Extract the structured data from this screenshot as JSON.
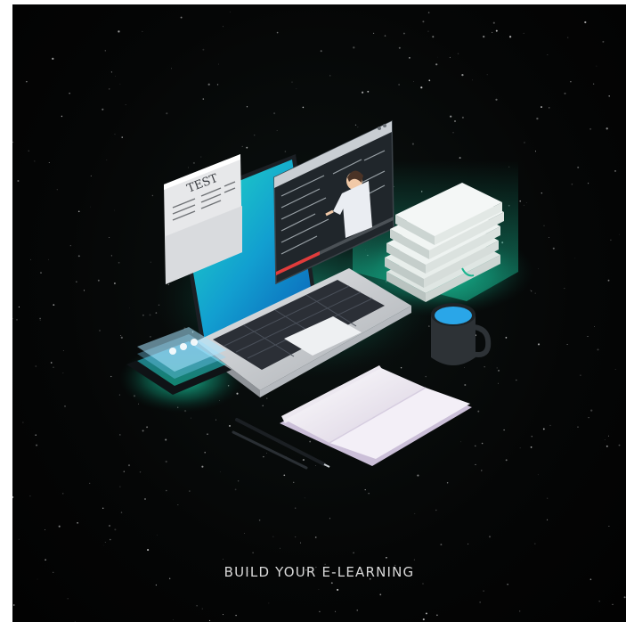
{
  "tagline": "BUILD YOUR E-LEARNING",
  "test_sheet": {
    "title": "TEST"
  },
  "colors": {
    "background": "#040505",
    "glow": "#19e0b0",
    "laptop_screen": "#18c3c8",
    "laptop_body": "#c9ccd0",
    "keyboard": "#2b2f36",
    "notebook": "#f1eef4",
    "mug_liquid": "#2aa6e8",
    "mug": "#2d3236",
    "books": "#e6ece9",
    "text": "#d9d9d9"
  },
  "icons": [
    "star-field",
    "paper-test-sheet",
    "laptop",
    "video-lesson-window",
    "teacher-figure",
    "book-stack",
    "coffee-mug",
    "open-notebook",
    "pen",
    "pencil",
    "smartphone"
  ]
}
